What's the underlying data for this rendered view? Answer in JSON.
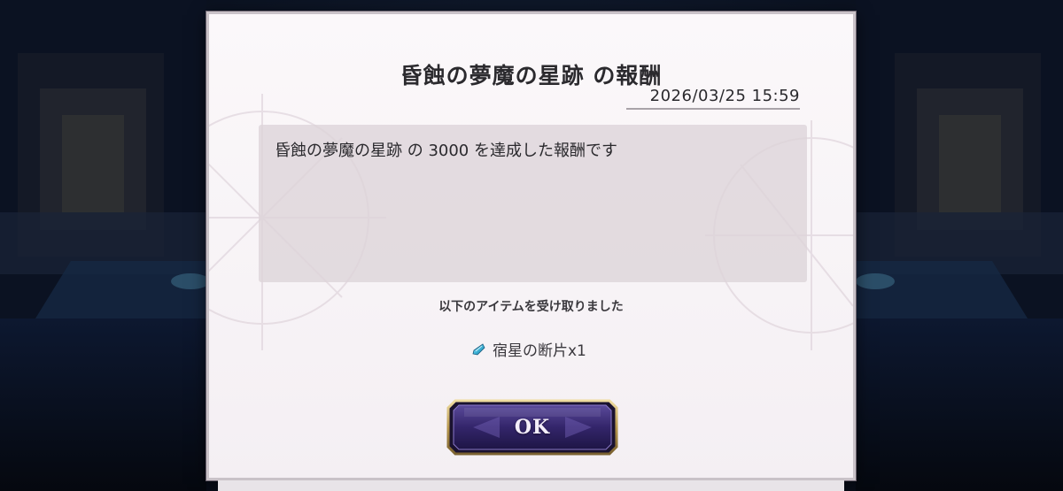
{
  "dialog": {
    "title": "昏蝕の夢魔の星跡 の報酬",
    "datetime": "2026/03/25 15:59",
    "message": "昏蝕の夢魔の星跡 の 3000 を達成した報酬です",
    "received_label": "以下のアイテムを受け取りました",
    "items": [
      {
        "icon": "star-shard-icon",
        "name": "宿星の断片x1"
      }
    ],
    "ok_label": "OK"
  },
  "colors": {
    "dialog_bg": "#f7f3f6",
    "message_box_bg": "#ddd3d9",
    "button_purple": "#3a2a6e",
    "button_gold": "#c8b06a",
    "item_icon_cyan": "#3fb6d9"
  }
}
